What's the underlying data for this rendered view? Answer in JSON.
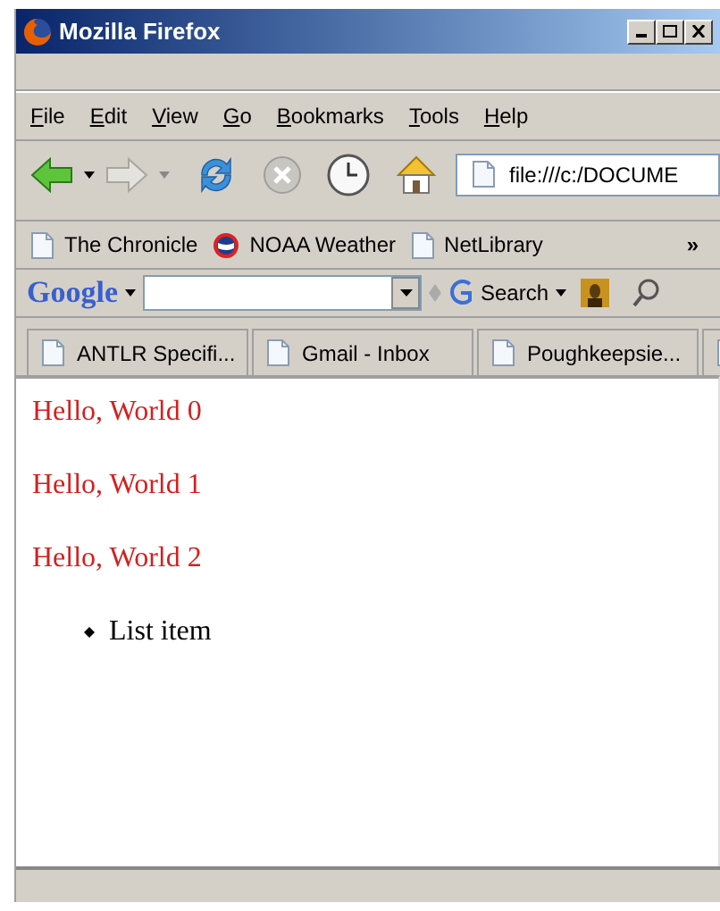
{
  "window": {
    "title": "Mozilla Firefox"
  },
  "menu": [
    "File",
    "Edit",
    "View",
    "Go",
    "Bookmarks",
    "Tools",
    "Help"
  ],
  "address": {
    "value": "file:///c:/DOCUME"
  },
  "bookmarks": [
    {
      "label": "The Chronicle",
      "kind": "page"
    },
    {
      "label": "NOAA Weather",
      "kind": "weather"
    },
    {
      "label": "NetLibrary",
      "kind": "page"
    }
  ],
  "bookmarks_overflow": "»",
  "google_toolbar": {
    "logo": "Google",
    "search_label": "Search"
  },
  "tabs": [
    {
      "label": "ANTLR Specifi..."
    },
    {
      "label": "Gmail - Inbox"
    },
    {
      "label": "Poughkeepsie..."
    }
  ],
  "partial_tab_shown": true,
  "content": {
    "paragraphs": [
      "Hello, World 0",
      "Hello, World 1",
      "Hello, World 2"
    ],
    "list": [
      "List item"
    ]
  }
}
